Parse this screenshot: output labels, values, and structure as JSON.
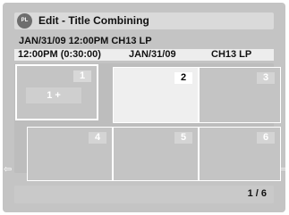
{
  "header": {
    "icon_label": "PL",
    "title": "Edit - Title Combining"
  },
  "info": {
    "line1": "JAN/31/09 12:00PM  CH13  LP",
    "time": "12:00PM (0:30:00)",
    "date": "JAN/31/09",
    "channel_mode": "CH13  LP"
  },
  "grid": {
    "cells": [
      {
        "number": "1",
        "label": "1 +"
      },
      {
        "number": "2"
      },
      {
        "number": "3"
      },
      {
        "number": "4"
      },
      {
        "number": "5"
      },
      {
        "number": "6"
      }
    ]
  },
  "nav": {
    "left_arrow": "⇦",
    "right_arrow": "⇨"
  },
  "footer": {
    "page": "1 / 6"
  }
}
